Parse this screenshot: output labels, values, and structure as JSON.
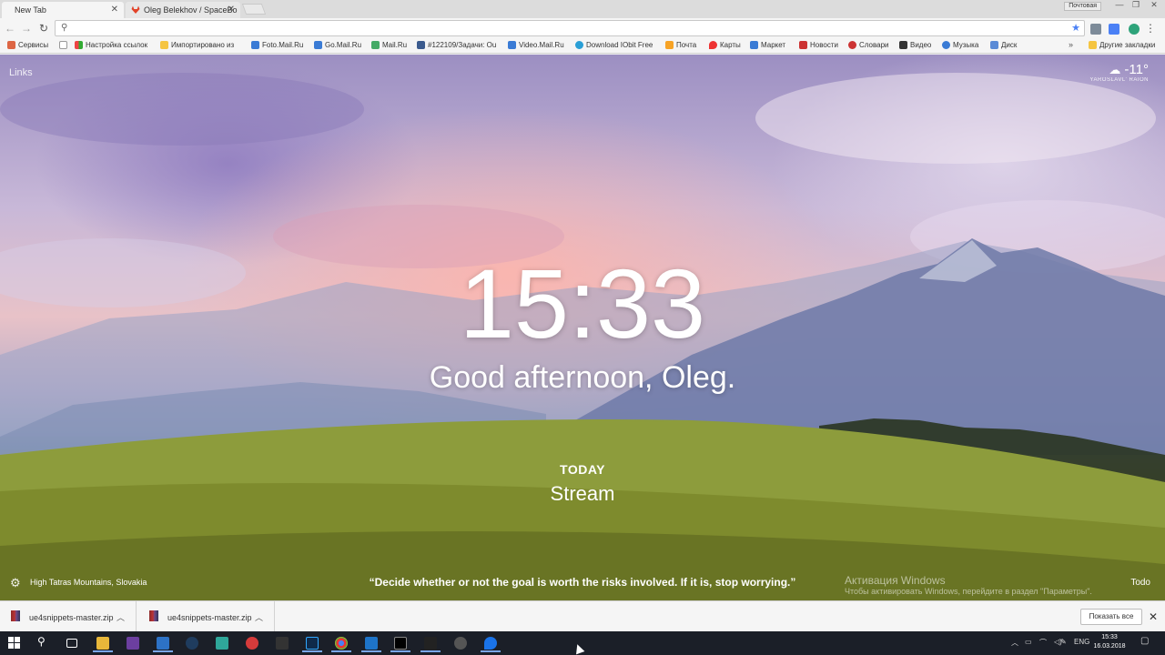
{
  "browser": {
    "tabs": [
      {
        "label": "New Tab",
        "active": true
      },
      {
        "label": "Oleg Belekhov / SpaceBo",
        "active": false
      }
    ],
    "profile_label": "Почтовая",
    "address": {
      "value": "",
      "placeholder": ""
    },
    "bookmarks": [
      "Сервисы",
      "Настройка ссылок",
      "Импортировано из",
      "Foto.Mail.Ru",
      "Go.Mail.Ru",
      "Mail.Ru",
      "#122109/Задачи: Ou",
      "Video.Mail.Ru",
      "Download IObit Free",
      "Почта",
      "Карты",
      "Маркет",
      "Новости",
      "Словари",
      "Видео",
      "Музыка",
      "Диск"
    ],
    "other_bookmarks": "Другие закладки"
  },
  "momentum": {
    "links_label": "Links",
    "weather": {
      "temp": "-11°",
      "location": "YAROSLAVL' RAION"
    },
    "time": "15:33",
    "greeting": "Good afternoon, Oleg.",
    "today_label": "TODAY",
    "focus": "Stream",
    "photo_location": "High Tatras Mountains, Slovakia",
    "quote": "“Decide whether or not the goal is worth the risks involved. If it is, stop worrying.”",
    "todo_label": "Todo"
  },
  "activation": {
    "title": "Активация Windows",
    "subtitle": "Чтобы активировать Windows, перейдите в раздел \"Параметры\"."
  },
  "downloads": {
    "items": [
      "ue4snippets-master.zip",
      "ue4snippets-master.zip"
    ],
    "show_all": "Показать все"
  },
  "taskbar": {
    "lang": "ENG",
    "time": "15:33",
    "date": "16.03.2018"
  },
  "colors": {
    "omnibox_star": "#4a80f5",
    "taskbar_bg": "#1b1f28",
    "taskbar_running": "#7aa7ee"
  }
}
